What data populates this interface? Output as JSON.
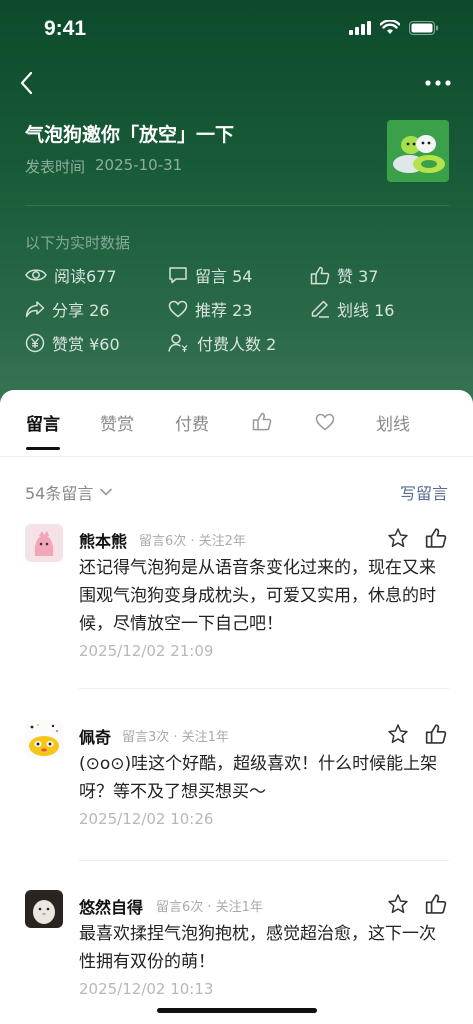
{
  "status_bar": {
    "time": "9:41"
  },
  "article": {
    "title": "气泡狗邀你「放空」一下",
    "publish_label": "发表时间",
    "publish_date": "2025-10-31"
  },
  "stats": {
    "realtime_label": "以下为实时数据",
    "read": "阅读677",
    "comments": "留言 54",
    "likes": "赞 37",
    "share": "分享 26",
    "recommend": "推荐 23",
    "highlight": "划线 16",
    "reward": "赞赏 ¥60",
    "payers": "付费人数 2"
  },
  "tabs": [
    {
      "label": "留言"
    },
    {
      "label": "赞赏"
    },
    {
      "label": "付费"
    },
    {
      "icon": "thumb-up-icon"
    },
    {
      "icon": "heart-icon"
    },
    {
      "label": "划线"
    }
  ],
  "comments_header": {
    "count_label": "54条留言",
    "write_label": "写留言"
  },
  "comments": [
    {
      "name": "熊本熊",
      "meta": "留言6次 · 关注2年",
      "text": "还记得气泡狗是从语音条变化过来的，现在又来围观气泡狗变身成枕头，可爱又实用，休息的时候，尽情放空一下自己吧！",
      "date": "2025/12/02 21:09"
    },
    {
      "name": "佩奇",
      "meta": "留言3次 · 关注1年",
      "text": "(⊙o⊙)哇这个好酷，超级喜欢！什么时候能上架呀？等不及了想买想买～",
      "date": "2025/12/02 10:26"
    },
    {
      "name": "悠然自得",
      "meta": "留言6次 · 关注1年",
      "text": "最喜欢揉捏气泡狗抱枕，感觉超治愈，这下一次性拥有双份的萌！",
      "date": "2025/12/02 10:13"
    }
  ],
  "colors": {
    "header_green": "#1a5d3a",
    "link_blue": "#576b95"
  }
}
